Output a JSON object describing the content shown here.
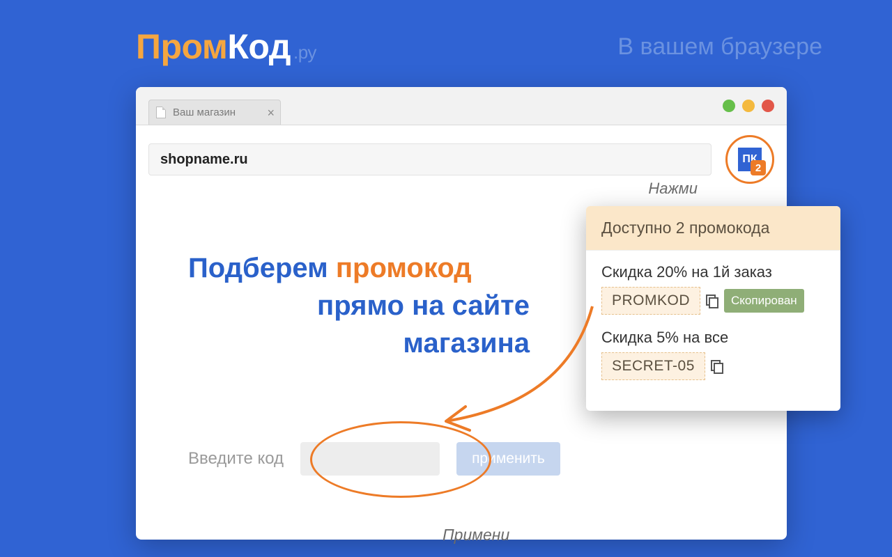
{
  "logo": {
    "part1": "Пром",
    "part2": "Код",
    "suffix": ".ру"
  },
  "tagline": "В вашем браузере",
  "browser": {
    "tab_title": "Ваш магазин",
    "address": "shopname.ru",
    "ext_icon_text": "ПК",
    "ext_badge_count": "2"
  },
  "hints": {
    "click": "Нажми",
    "apply": "Примени"
  },
  "headline": {
    "pre": "Подберем ",
    "accent": "промокод",
    "line2": "прямо на сайте",
    "line3": "магазина"
  },
  "code_row": {
    "label": "Введите код",
    "apply_button": "применить"
  },
  "popup": {
    "header": "Доступно 2 промокода",
    "items": [
      {
        "desc": "Скидка 20% на 1й заказ",
        "code": "PROMKOD",
        "copied": "Скопирован"
      },
      {
        "desc": "Скидка 5% на все",
        "code": "SECRET-05"
      }
    ]
  }
}
